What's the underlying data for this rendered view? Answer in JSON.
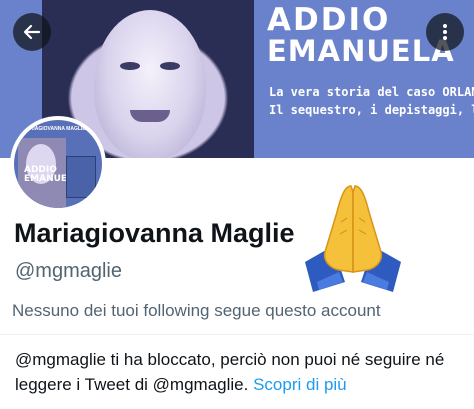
{
  "banner": {
    "title_line1": "ADDIO",
    "title_line2": "EMANUELA",
    "subtitle_line1": "La vera storia del caso ORLANDI",
    "subtitle_line2": "Il sequestro, i depistaggi, la soluzione",
    "photo_overlay": "ADDIO"
  },
  "avatar": {
    "cover_title": "MARIAGIOVANNA MAGLIE",
    "cover_addio": "ADDIO",
    "cover_emanuela": "EMANUELA"
  },
  "profile": {
    "name": "Mariagiovanna Maglie",
    "handle": "@mgmaglie",
    "following_note": "Nessuno dei tuoi following segue questo account"
  },
  "blocked": {
    "message": "@mgmaglie ti ha bloccato, perciò non puoi né seguire né leggere i Tweet di @mgmaglie.",
    "learn_more": "Scopri di più"
  },
  "icons": {
    "back": "arrow-left-icon",
    "more": "more-dots-icon",
    "emoji": "folded-hands-emoji"
  },
  "colors": {
    "banner": "#6a82cb",
    "text_primary": "#0f1419",
    "text_secondary": "#536471",
    "link": "#1d9bf0",
    "emoji_hands": "#f5c13b",
    "emoji_sleeve": "#2e5bbf"
  }
}
